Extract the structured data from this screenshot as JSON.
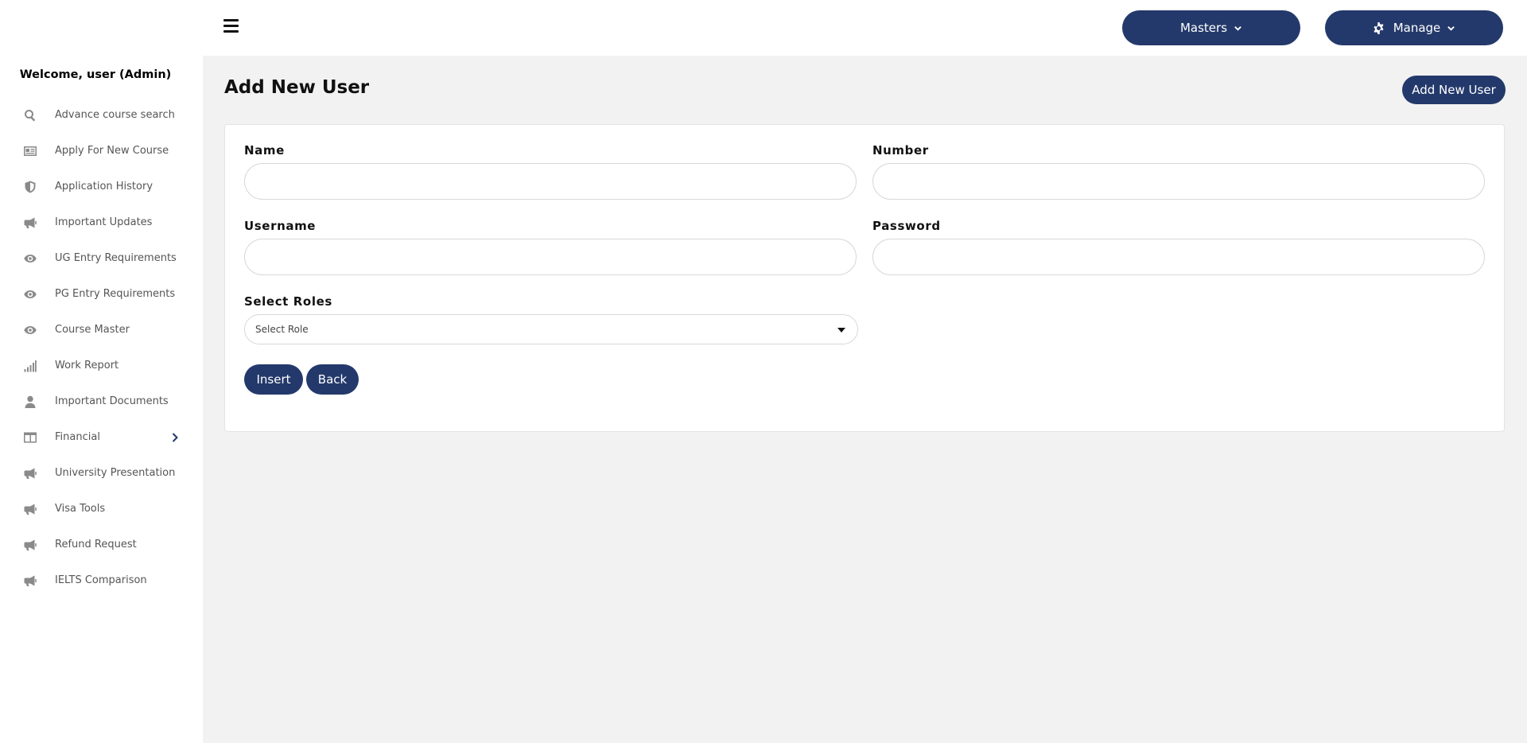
{
  "sidebar": {
    "welcome": "Welcome, user (Admin)",
    "items": [
      {
        "label": "Advance course search",
        "icon": "search-icon"
      },
      {
        "label": "Apply For New Course",
        "icon": "id-card-icon"
      },
      {
        "label": "Application History",
        "icon": "shield-icon"
      },
      {
        "label": "Important Updates",
        "icon": "megaphone-icon"
      },
      {
        "label": "UG Entry Requirements",
        "icon": "eye-icon"
      },
      {
        "label": "PG Entry Requirements",
        "icon": "eye-icon"
      },
      {
        "label": "Course Master",
        "icon": "eye-icon"
      },
      {
        "label": "Work Report",
        "icon": "signal-bars-icon"
      },
      {
        "label": "Important Documents",
        "icon": "user-icon"
      },
      {
        "label": "Financial",
        "icon": "table-icon"
      },
      {
        "label": "University Presentation",
        "icon": "megaphone-icon"
      },
      {
        "label": "Visa Tools",
        "icon": "megaphone-icon"
      },
      {
        "label": "Refund Request",
        "icon": "megaphone-icon"
      },
      {
        "label": "IELTS Comparison",
        "icon": "megaphone-icon"
      }
    ]
  },
  "topbar": {
    "masters_label": "Masters",
    "manage_label": "Manage"
  },
  "page": {
    "title": "Add New User",
    "add_button": "Add New User"
  },
  "form": {
    "name_label": "Name",
    "name_value": "",
    "number_label": "Number",
    "number_value": "",
    "username_label": "Username",
    "username_value": "",
    "password_label": "Password",
    "password_value": "",
    "roles_label": "Select Roles",
    "roles_selected": "Select Role",
    "insert_label": "Insert",
    "back_label": "Back"
  },
  "colors": {
    "accent": "#24396b",
    "background": "#f2f2f2"
  }
}
